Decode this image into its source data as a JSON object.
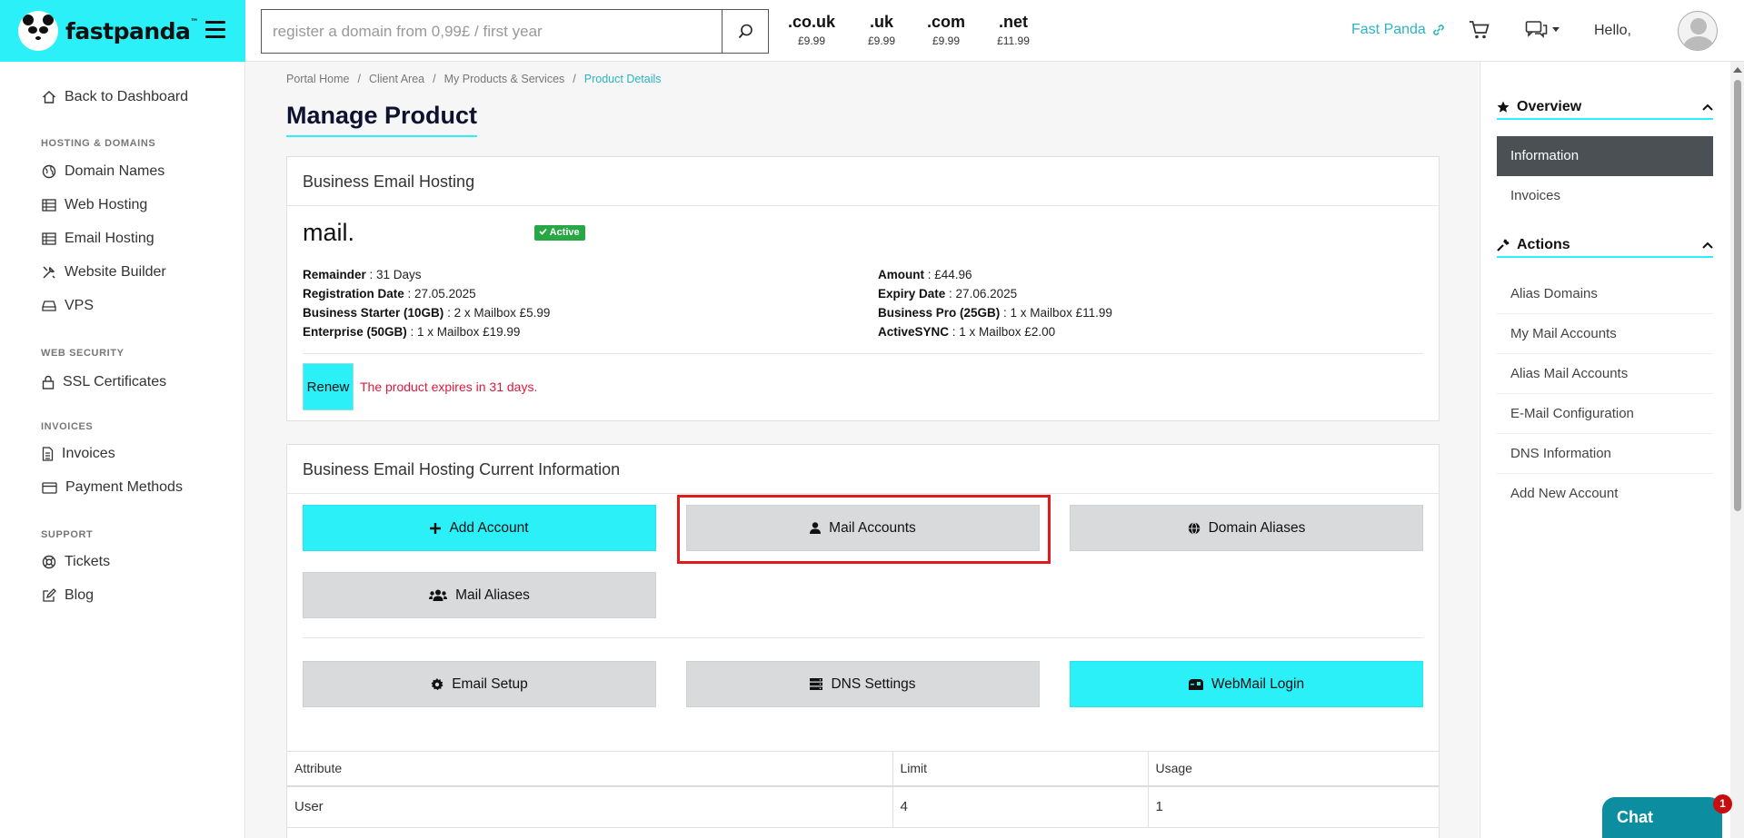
{
  "brand": {
    "name": "fastpanda",
    "tm": "™"
  },
  "search": {
    "placeholder": "register a domain from 0,99£ / first year"
  },
  "tlds": [
    {
      "ext": ".co.uk",
      "price": "£9.99"
    },
    {
      "ext": ".uk",
      "price": "£9.99"
    },
    {
      "ext": ".com",
      "price": "£9.99"
    },
    {
      "ext": ".net",
      "price": "£11.99"
    }
  ],
  "header": {
    "link": "Fast Panda",
    "hello": "Hello,"
  },
  "sidebar": {
    "back": "Back to Dashboard",
    "sections": [
      "HOSTING & DOMAINS",
      "WEB SECURITY",
      "INVOICES",
      "SUPPORT"
    ],
    "items": [
      "Domain Names",
      "Web Hosting",
      "Email Hosting",
      "Website Builder",
      "VPS",
      "SSL Certificates",
      "Invoices",
      "Payment Methods",
      "Tickets",
      "Blog"
    ]
  },
  "breadcrumb": [
    "Portal Home",
    "/",
    "Client Area",
    "/",
    "My Products & Services",
    "/",
    "Product Details"
  ],
  "page_title": "Manage Product",
  "product": {
    "card_title": "Business Email Hosting",
    "domain": "mail.",
    "status": "Active",
    "left": [
      {
        "label": "Remainder",
        "value": " : 31 Days"
      },
      {
        "label": "Registration Date",
        "value": " : 27.05.2025"
      },
      {
        "label": "Business Starter (10GB)",
        "value": " : 2 x Mailbox £5.99"
      },
      {
        "label": "Enterprise (50GB)",
        "value": " : 1 x Mailbox £19.99"
      }
    ],
    "right": [
      {
        "label": "Amount",
        "value": " : £44.96"
      },
      {
        "label": "Expiry Date",
        "value": " : 27.06.2025"
      },
      {
        "label": "Business Pro (25GB)",
        "value": " : 1 x Mailbox £11.99"
      },
      {
        "label": "ActiveSYNC",
        "value": " : 1 x Mailbox £2.00"
      }
    ],
    "renew": "Renew",
    "expire_notice": "The product expires in 31 days."
  },
  "current": {
    "card_title": "Business Email Hosting Current Information",
    "buttons": {
      "add_account": "Add Account",
      "mail_accounts": "Mail Accounts",
      "domain_aliases": "Domain Aliases",
      "mail_aliases": "Mail Aliases",
      "email_setup": "Email Setup",
      "dns_settings": "DNS Settings",
      "webmail_login": "WebMail Login"
    },
    "table": {
      "headers": [
        "Attribute",
        "Limit",
        "Usage"
      ],
      "rows": [
        [
          "User",
          "4",
          "1"
        ]
      ]
    }
  },
  "right_sidebar": {
    "overview": "Overview",
    "overview_items": [
      "Information",
      "Invoices"
    ],
    "actions": "Actions",
    "action_items": [
      "Alias Domains",
      "My Mail Accounts",
      "Alias Mail Accounts",
      "E-Mail Configuration",
      "DNS Information",
      "Add New Account"
    ]
  },
  "chat": {
    "label": "Chat",
    "count": "1"
  },
  "colors": {
    "accent": "#2cf0f8",
    "link": "#2ab4c4",
    "danger": "#e0183c",
    "active_badge": "#28a745",
    "highlight": "#e21a1a"
  }
}
